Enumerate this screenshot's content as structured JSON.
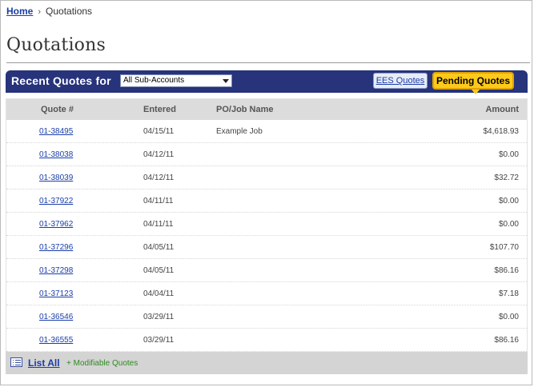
{
  "breadcrumb": {
    "home": "Home",
    "separator": "›",
    "current": "Quotations"
  },
  "page": {
    "title": "Quotations"
  },
  "header": {
    "title": "Recent Quotes for",
    "subaccount_selected": "All Sub-Accounts",
    "tabs": [
      {
        "label": "EES Quotes",
        "active": false
      },
      {
        "label": "Pending Quotes",
        "active": true
      }
    ]
  },
  "table": {
    "columns": [
      "Quote #",
      "Entered",
      "PO/Job Name",
      "Amount"
    ],
    "rows": [
      {
        "quote": "01-38495",
        "entered": "04/15/11",
        "job": "Example Job",
        "amount": "$4,618.93"
      },
      {
        "quote": "01-38038",
        "entered": "04/12/11",
        "job": "",
        "amount": "$0.00"
      },
      {
        "quote": "01-38039",
        "entered": "04/12/11",
        "job": "",
        "amount": "$32.72"
      },
      {
        "quote": "01-37922",
        "entered": "04/11/11",
        "job": "",
        "amount": "$0.00"
      },
      {
        "quote": "01-37962",
        "entered": "04/11/11",
        "job": "",
        "amount": "$0.00"
      },
      {
        "quote": "01-37296",
        "entered": "04/05/11",
        "job": "",
        "amount": "$107.70"
      },
      {
        "quote": "01-37298",
        "entered": "04/05/11",
        "job": "",
        "amount": "$86.16"
      },
      {
        "quote": "01-37123",
        "entered": "04/04/11",
        "job": "",
        "amount": "$7.18"
      },
      {
        "quote": "01-36546",
        "entered": "03/29/11",
        "job": "",
        "amount": "$0.00"
      },
      {
        "quote": "01-36555",
        "entered": "03/29/11",
        "job": "",
        "amount": "$86.16"
      }
    ]
  },
  "footer": {
    "list_all": "List All",
    "modifiable": "+ Modifiable Quotes",
    "icon": "list-icon"
  },
  "colors": {
    "header_bg": "#27337a",
    "active_tab": "#fcca1c",
    "link": "#1a3ea8",
    "green_note": "#2e8a1d"
  }
}
